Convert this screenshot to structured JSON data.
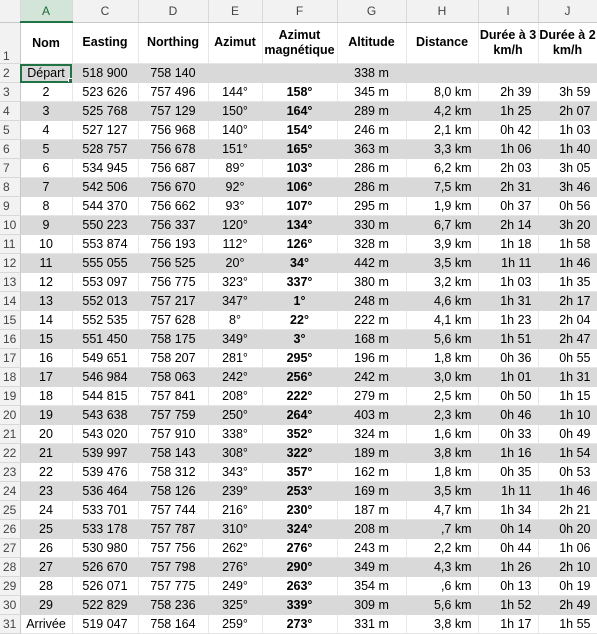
{
  "column_letters": [
    "A",
    "C",
    "D",
    "E",
    "F",
    "G",
    "H",
    "I",
    "J"
  ],
  "headers": {
    "nom": "Nom",
    "easting": "Easting",
    "northing": "Northing",
    "azimut": "Azimut",
    "azimut_mag": "Azimut magnétique",
    "altitude": "Altitude",
    "distance": "Distance",
    "duree3": "Durée à 3 km/h",
    "duree2": "Durée à 2 km/h"
  },
  "rows": [
    {
      "n": "2",
      "nom": "Départ",
      "easting": "518 900",
      "northing": "758 140",
      "azimut": "",
      "mag": "",
      "alt": "338 m",
      "dist": "",
      "d3": "",
      "d2": ""
    },
    {
      "n": "3",
      "nom": "2",
      "easting": "523 626",
      "northing": "757 496",
      "azimut": "144°",
      "mag": "158°",
      "alt": "345 m",
      "dist": "8,0 km",
      "d3": "2h 39",
      "d2": "3h 59"
    },
    {
      "n": "4",
      "nom": "3",
      "easting": "525 768",
      "northing": "757 129",
      "azimut": "150°",
      "mag": "164°",
      "alt": "289 m",
      "dist": "4,2 km",
      "d3": "1h 25",
      "d2": "2h 07"
    },
    {
      "n": "5",
      "nom": "4",
      "easting": "527 127",
      "northing": "756 968",
      "azimut": "140°",
      "mag": "154°",
      "alt": "246 m",
      "dist": "2,1 km",
      "d3": "0h 42",
      "d2": "1h 03"
    },
    {
      "n": "6",
      "nom": "5",
      "easting": "528 757",
      "northing": "756 678",
      "azimut": "151°",
      "mag": "165°",
      "alt": "363 m",
      "dist": "3,3 km",
      "d3": "1h 06",
      "d2": "1h 40"
    },
    {
      "n": "7",
      "nom": "6",
      "easting": "534 945",
      "northing": "756 687",
      "azimut": "89°",
      "mag": "103°",
      "alt": "286 m",
      "dist": "6,2 km",
      "d3": "2h 03",
      "d2": "3h 05"
    },
    {
      "n": "8",
      "nom": "7",
      "easting": "542 506",
      "northing": "756 670",
      "azimut": "92°",
      "mag": "106°",
      "alt": "286 m",
      "dist": "7,5 km",
      "d3": "2h 31",
      "d2": "3h 46"
    },
    {
      "n": "9",
      "nom": "8",
      "easting": "544 370",
      "northing": "756 662",
      "azimut": "93°",
      "mag": "107°",
      "alt": "295 m",
      "dist": "1,9 km",
      "d3": "0h 37",
      "d2": "0h 56"
    },
    {
      "n": "10",
      "nom": "9",
      "easting": "550 223",
      "northing": "756 337",
      "azimut": "120°",
      "mag": "134°",
      "alt": "330 m",
      "dist": "6,7 km",
      "d3": "2h 14",
      "d2": "3h 20"
    },
    {
      "n": "11",
      "nom": "10",
      "easting": "553 874",
      "northing": "756 193",
      "azimut": "112°",
      "mag": "126°",
      "alt": "328 m",
      "dist": "3,9 km",
      "d3": "1h 18",
      "d2": "1h 58"
    },
    {
      "n": "12",
      "nom": "11",
      "easting": "555 055",
      "northing": "756 525",
      "azimut": "20°",
      "mag": "34°",
      "alt": "442 m",
      "dist": "3,5 km",
      "d3": "1h 11",
      "d2": "1h 46"
    },
    {
      "n": "13",
      "nom": "12",
      "easting": "553 097",
      "northing": "756 775",
      "azimut": "323°",
      "mag": "337°",
      "alt": "380 m",
      "dist": "3,2 km",
      "d3": "1h 03",
      "d2": "1h 35"
    },
    {
      "n": "14",
      "nom": "13",
      "easting": "552 013",
      "northing": "757 217",
      "azimut": "347°",
      "mag": "1°",
      "alt": "248 m",
      "dist": "4,6 km",
      "d3": "1h 31",
      "d2": "2h 17"
    },
    {
      "n": "15",
      "nom": "14",
      "easting": "552 535",
      "northing": "757 628",
      "azimut": "8°",
      "mag": "22°",
      "alt": "222 m",
      "dist": "4,1 km",
      "d3": "1h 23",
      "d2": "2h 04"
    },
    {
      "n": "16",
      "nom": "15",
      "easting": "551 450",
      "northing": "758 175",
      "azimut": "349°",
      "mag": "3°",
      "alt": "168 m",
      "dist": "5,6 km",
      "d3": "1h 51",
      "d2": "2h 47"
    },
    {
      "n": "17",
      "nom": "16",
      "easting": "549 651",
      "northing": "758 207",
      "azimut": "281°",
      "mag": "295°",
      "alt": "196 m",
      "dist": "1,8 km",
      "d3": "0h 36",
      "d2": "0h 55"
    },
    {
      "n": "18",
      "nom": "17",
      "easting": "546 984",
      "northing": "758 063",
      "azimut": "242°",
      "mag": "256°",
      "alt": "242 m",
      "dist": "3,0 km",
      "d3": "1h 01",
      "d2": "1h 31"
    },
    {
      "n": "19",
      "nom": "18",
      "easting": "544 815",
      "northing": "757 841",
      "azimut": "208°",
      "mag": "222°",
      "alt": "279 m",
      "dist": "2,5 km",
      "d3": "0h 50",
      "d2": "1h 15"
    },
    {
      "n": "20",
      "nom": "19",
      "easting": "543 638",
      "northing": "757 759",
      "azimut": "250°",
      "mag": "264°",
      "alt": "403 m",
      "dist": "2,3 km",
      "d3": "0h 46",
      "d2": "1h 10"
    },
    {
      "n": "21",
      "nom": "20",
      "easting": "543 020",
      "northing": "757 910",
      "azimut": "338°",
      "mag": "352°",
      "alt": "324 m",
      "dist": "1,6 km",
      "d3": "0h 33",
      "d2": "0h 49"
    },
    {
      "n": "22",
      "nom": "21",
      "easting": "539 997",
      "northing": "758 143",
      "azimut": "308°",
      "mag": "322°",
      "alt": "189 m",
      "dist": "3,8 km",
      "d3": "1h 16",
      "d2": "1h 54"
    },
    {
      "n": "23",
      "nom": "22",
      "easting": "539 476",
      "northing": "758 312",
      "azimut": "343°",
      "mag": "357°",
      "alt": "162 m",
      "dist": "1,8 km",
      "d3": "0h 35",
      "d2": "0h 53"
    },
    {
      "n": "24",
      "nom": "23",
      "easting": "536 464",
      "northing": "758 126",
      "azimut": "239°",
      "mag": "253°",
      "alt": "169 m",
      "dist": "3,5 km",
      "d3": "1h 11",
      "d2": "1h 46"
    },
    {
      "n": "25",
      "nom": "24",
      "easting": "533 701",
      "northing": "757 744",
      "azimut": "216°",
      "mag": "230°",
      "alt": "187 m",
      "dist": "4,7 km",
      "d3": "1h 34",
      "d2": "2h 21"
    },
    {
      "n": "26",
      "nom": "25",
      "easting": "533 178",
      "northing": "757 787",
      "azimut": "310°",
      "mag": "324°",
      "alt": "208 m",
      "dist": ",7 km",
      "d3": "0h 14",
      "d2": "0h 20"
    },
    {
      "n": "27",
      "nom": "26",
      "easting": "530 980",
      "northing": "757 756",
      "azimut": "262°",
      "mag": "276°",
      "alt": "243 m",
      "dist": "2,2 km",
      "d3": "0h 44",
      "d2": "1h 06"
    },
    {
      "n": "28",
      "nom": "27",
      "easting": "526 670",
      "northing": "757 798",
      "azimut": "276°",
      "mag": "290°",
      "alt": "349 m",
      "dist": "4,3 km",
      "d3": "1h 26",
      "d2": "2h 10"
    },
    {
      "n": "29",
      "nom": "28",
      "easting": "526 071",
      "northing": "757 775",
      "azimut": "249°",
      "mag": "263°",
      "alt": "354 m",
      "dist": ",6 km",
      "d3": "0h 13",
      "d2": "0h 19"
    },
    {
      "n": "30",
      "nom": "29",
      "easting": "522 829",
      "northing": "758 236",
      "azimut": "325°",
      "mag": "339°",
      "alt": "309 m",
      "dist": "5,6 km",
      "d3": "1h 52",
      "d2": "2h 49"
    },
    {
      "n": "31",
      "nom": "Arrivée",
      "easting": "519 047",
      "northing": "758 164",
      "azimut": "259°",
      "mag": "273°",
      "alt": "331 m",
      "dist": "3,8 km",
      "d3": "1h 17",
      "d2": "1h 55"
    }
  ],
  "colors": {
    "shade": "#d9d9d9",
    "selection": "#217346"
  }
}
